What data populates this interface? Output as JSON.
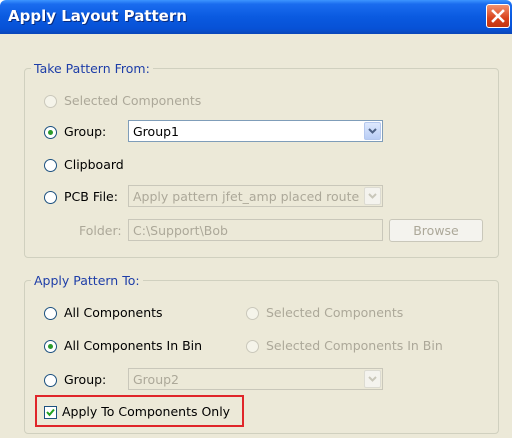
{
  "window": {
    "title": "Apply Layout Pattern"
  },
  "take_pattern": {
    "legend": "Take Pattern From:",
    "selected_components": {
      "label": "Selected Components",
      "selected": false,
      "enabled": false
    },
    "group": {
      "label": "Group:",
      "selected": true,
      "value": "Group1"
    },
    "clipboard": {
      "label": "Clipboard",
      "selected": false
    },
    "pcb_file": {
      "label": "PCB File:",
      "selected": false,
      "value": "Apply pattern jfet_amp placed route"
    },
    "folder": {
      "label": "Folder:",
      "value": "C:\\Support\\Bob",
      "browse_label": "Browse"
    }
  },
  "apply_pattern": {
    "legend": "Apply Pattern To:",
    "all_components": {
      "label": "All Components",
      "selected": false
    },
    "selected_components": {
      "label": "Selected Components",
      "enabled": false
    },
    "all_components_in_bin": {
      "label": "All Components In Bin",
      "selected": true
    },
    "selected_components_in_bin": {
      "label": "Selected Components In Bin",
      "enabled": false
    },
    "group": {
      "label": "Group:",
      "selected": false,
      "value": "Group2"
    },
    "apply_to_components_only": {
      "label": "Apply To Components Only",
      "checked": true
    }
  },
  "colors": {
    "titlebar": "#0a5ae0",
    "dialog_bg": "#ece9d8",
    "group_legend": "#1e3ea8",
    "radio_dot": "#2b9a2b",
    "highlight": "#e0262a"
  },
  "icons": {
    "close": "close-icon",
    "dropdown": "chevron-down-icon",
    "check": "check-icon"
  }
}
